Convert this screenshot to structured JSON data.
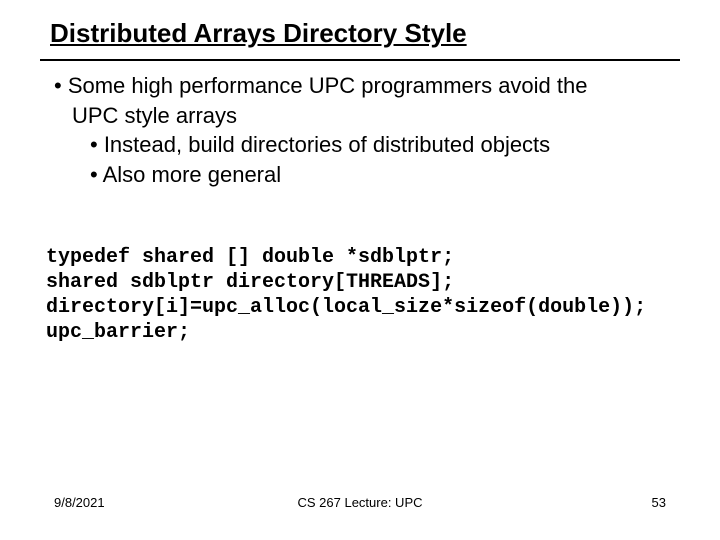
{
  "title": "Distributed Arrays Directory Style",
  "bullets": {
    "b1": "• Some high performance UPC programmers avoid the",
    "b1cont": "UPC style arrays",
    "b2a": "• Instead, build directories of distributed objects",
    "b2b": "• Also more general"
  },
  "code": "typedef shared [] double *sdblptr;\nshared sdblptr directory[THREADS];\ndirectory[i]=upc_alloc(local_size*sizeof(double));\nupc_barrier;",
  "footer": {
    "date": "9/8/2021",
    "center": "CS 267 Lecture: UPC",
    "page": "53"
  }
}
